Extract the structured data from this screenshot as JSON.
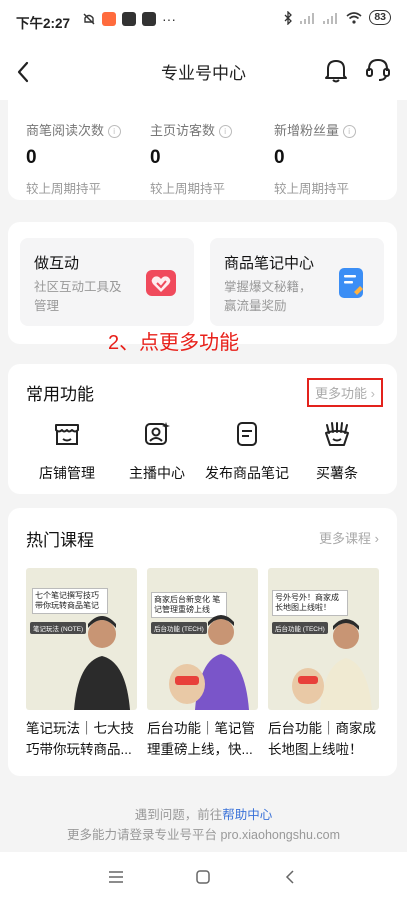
{
  "status": {
    "time": "下午2:27",
    "battery": "83"
  },
  "nav": {
    "title": "专业号中心"
  },
  "stats": [
    {
      "label": "商笔阅读次数",
      "value": "0",
      "compare": "较上周期持平"
    },
    {
      "label": "主页访客数",
      "value": "0",
      "compare": "较上周期持平"
    },
    {
      "label": "新增粉丝量",
      "value": "0",
      "compare": "较上周期持平"
    }
  ],
  "tools": [
    {
      "name": "做互动",
      "desc": "社区互动工具及管理"
    },
    {
      "name": "商品笔记中心",
      "desc": "掌握爆文秘籍，赢流量奖励"
    }
  ],
  "annotation": "2、点更多功能",
  "common": {
    "title": "常用功能",
    "more": "更多功能",
    "items": [
      {
        "label": "店铺管理",
        "icon": "store-icon"
      },
      {
        "label": "主播中心",
        "icon": "anchor-icon"
      },
      {
        "label": "发布商品笔记",
        "icon": "note-icon"
      },
      {
        "label": "买薯条",
        "icon": "fries-icon"
      }
    ]
  },
  "hot": {
    "title": "热门课程",
    "more": "更多课程",
    "courses": [
      {
        "title": "笔记玩法｜七大技巧带你玩转商品...",
        "thumb_text": "七个笔记撰写技巧带你玩转商品笔记",
        "tag": "笔记玩法 (NOTE)"
      },
      {
        "title": "后台功能｜笔记管理重磅上线，快...",
        "thumb_text": "商家后台新变化 笔记管理重磅上线",
        "tag": "后台功能 (TECH)"
      },
      {
        "title": "后台功能｜商家成长地图上线啦！🗺",
        "thumb_text": "号外号外！商家成长地图上线啦！",
        "tag": "后台功能 (TECH)"
      }
    ]
  },
  "footer": {
    "line1_prefix": "遇到问题，前往",
    "help_link": "帮助中心",
    "line2": "更多能力请登录专业号平台 pro.xiaohongshu.com"
  },
  "colors": {
    "accent_red": "#e3221c",
    "link_blue": "#3a72d8"
  }
}
